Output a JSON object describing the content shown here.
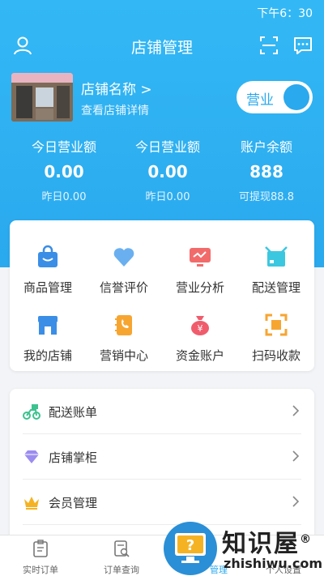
{
  "status_bar": {
    "time": "下午6：30"
  },
  "topbar": {
    "title": "店铺管理"
  },
  "shop": {
    "name": "店铺名称 >",
    "detail_link": "查看店铺详情",
    "toggle_label": "营业"
  },
  "stats": [
    {
      "label": "今日营业额",
      "value": "0.00",
      "sub": "昨日0.00"
    },
    {
      "label": "今日营业额",
      "value": "0.00",
      "sub": "昨日0.00"
    },
    {
      "label": "账户余额",
      "value": "888",
      "sub": "可提现88.8"
    }
  ],
  "grid": [
    {
      "label": "商品管理",
      "icon": "shopping-bag-icon"
    },
    {
      "label": "信誉评价",
      "icon": "heart-icon"
    },
    {
      "label": "营业分析",
      "icon": "monitor-chart-icon"
    },
    {
      "label": "配送管理",
      "icon": "box-icon"
    },
    {
      "label": "我的店铺",
      "icon": "storefront-icon"
    },
    {
      "label": "营销中心",
      "icon": "phone-book-icon"
    },
    {
      "label": "资金账户",
      "icon": "money-bag-icon"
    },
    {
      "label": "扫码收款",
      "icon": "scan-icon"
    }
  ],
  "list": [
    {
      "label": "配送账单",
      "icon": "scooter-icon"
    },
    {
      "label": "店铺掌柜",
      "icon": "diamond-icon"
    },
    {
      "label": "会员管理",
      "icon": "crown-icon"
    }
  ],
  "tabs": [
    {
      "label": "实时订单"
    },
    {
      "label": "订单查询"
    },
    {
      "label": "管理"
    },
    {
      "label": "个人设置"
    }
  ],
  "watermark": {
    "text": "知识屋",
    "url": "zhishiwu.com",
    "reg": "®"
  },
  "colors": {
    "primary": "#2aa9ee",
    "background": "#f2f4f7"
  }
}
